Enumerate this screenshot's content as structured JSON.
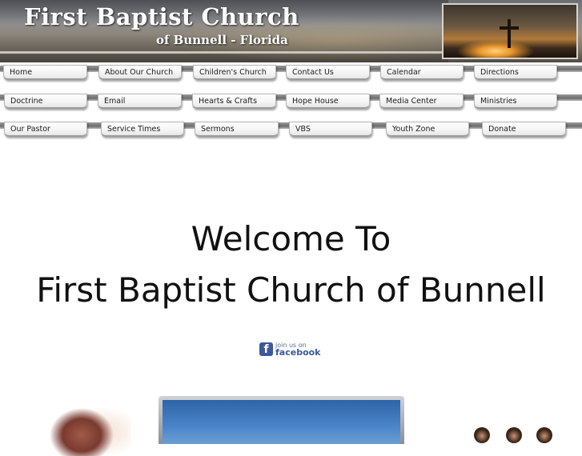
{
  "header": {
    "title": "First Baptist Church",
    "subtitle": "of Bunnell - Florida"
  },
  "nav": {
    "row1": [
      "Home",
      "About Our Church",
      "Children's Church",
      "Contact Us",
      "Calendar",
      "Directions"
    ],
    "row2": [
      "Doctrine",
      "Email",
      "Hearts & Crafts",
      "Hope House",
      "Media Center",
      "Ministries"
    ],
    "row3": [
      "Our Pastor",
      "Service Times",
      "Sermons",
      "VBS",
      "Youth Zone",
      "Donate"
    ]
  },
  "welcome": {
    "line1": "Welcome To",
    "line2": "First Baptist Church of Bunnell"
  },
  "facebook": {
    "line1": "join us on",
    "line2": "facebook",
    "icon": "facebook-icon",
    "color": "#3b5998"
  }
}
